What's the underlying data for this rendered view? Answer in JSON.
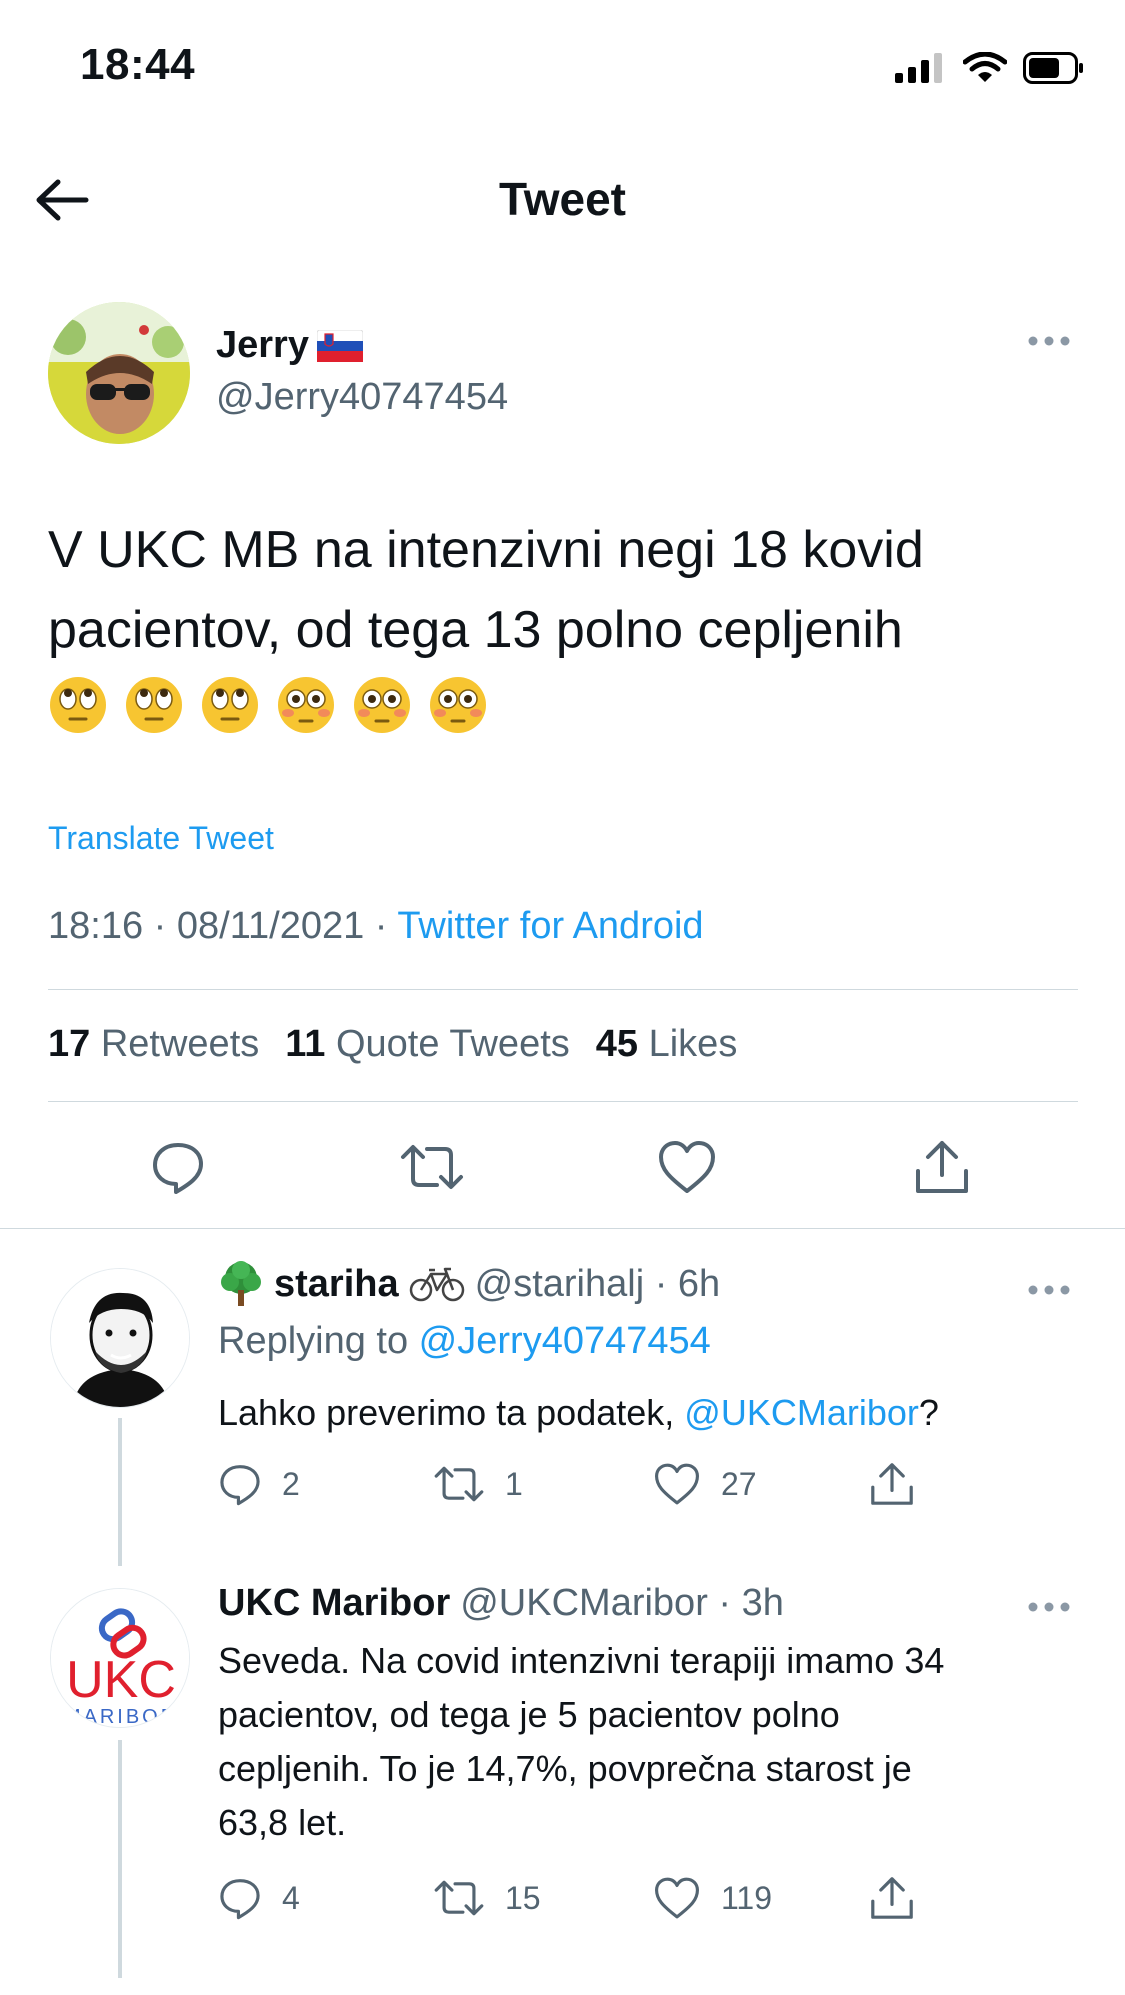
{
  "status_bar": {
    "time": "18:44"
  },
  "header": {
    "title": "Tweet"
  },
  "tweet": {
    "author_name": "Jerry",
    "author_handle": "@Jerry40747454",
    "text_line1": "V UKC MB na intenzivni negi 18 kovid",
    "text_line2": "pacientov, od tega 13 polno cepljenih",
    "emojis": [
      "rolling-eyes",
      "rolling-eyes",
      "rolling-eyes",
      "flushed",
      "flushed",
      "flushed"
    ],
    "translate_label": "Translate Tweet",
    "timestamp": "18:16 · 08/11/2021 · ",
    "source": "Twitter for Android",
    "retweets_count": "17",
    "retweets_label": "Retweets",
    "quotes_count": "11",
    "quotes_label": "Quote Tweets",
    "likes_count": "45",
    "likes_label": "Likes"
  },
  "replies": [
    {
      "name": "stariha",
      "handle_time": "@starihalj · 6h",
      "replying_prefix": "Replying to ",
      "replying_to": "@Jerry40747454",
      "text_before": "Lahko preverimo ta podatek, ",
      "text_mention": "@UKCMaribor",
      "text_after": "?",
      "reply_count": "2",
      "retweet_count": "1",
      "like_count": "27"
    },
    {
      "name": "UKC Maribor",
      "handle_time": "@UKCMaribor · 3h",
      "line1": "Seveda. Na covid intenzivni terapiji imamo 34",
      "line2": "pacientov, od tega je 5 pacientov polno",
      "line3": "cepljenih. To je 14,7%, povprečna starost je",
      "line4": "63,8 let.",
      "logo_text": "UKC",
      "logo_subtext": "MARIBOR",
      "reply_count": "4",
      "retweet_count": "15",
      "like_count": "119"
    }
  ],
  "colors": {
    "link": "#1d9bf0",
    "secondary": "#536471",
    "primary": "#0f1419",
    "divider": "#cfd9de",
    "ukc_red": "#e0202e"
  }
}
